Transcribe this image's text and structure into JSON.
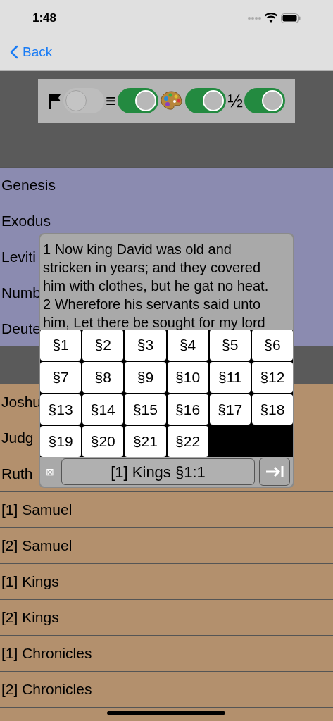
{
  "status_bar": {
    "time": "1:48"
  },
  "nav": {
    "back": "Back"
  },
  "toggles": [
    {
      "kind": "flag",
      "on": false
    },
    {
      "kind": "text",
      "text": "≡",
      "on": true
    },
    {
      "kind": "palette",
      "on": true
    },
    {
      "kind": "text",
      "text": "½",
      "on": true
    }
  ],
  "sections": [
    {
      "color": "#8b8bb0",
      "books": [
        "Genesis",
        "Exodus",
        "Leviti",
        "Numb",
        "Deute"
      ]
    },
    {
      "color": "#b3906d",
      "books": [
        "Joshu",
        "Judg",
        "Ruth",
        "[1] Samuel",
        "[2] Samuel",
        "[1] Kings",
        "[2] Kings",
        "[1] Chronicles",
        "[2] Chronicles"
      ]
    }
  ],
  "popup": {
    "text_lines": [
      "1 Now king David was old and",
      "stricken in years; and they covered",
      "him with clothes, but he gat no heat.",
      "2 Wherefore his servants said unto",
      "him, Let there be sought for my lord"
    ],
    "chapters": [
      "§1",
      "§2",
      "§3",
      "§4",
      "§5",
      "§6",
      "§7",
      "§8",
      "§9",
      "§10",
      "§11",
      "§12",
      "§13",
      "§14",
      "§15",
      "§16",
      "§17",
      "§18",
      "§19",
      "§20",
      "§21",
      "§22"
    ],
    "close_glyph": "⊠",
    "reference": "[1] Kings §1:1"
  }
}
